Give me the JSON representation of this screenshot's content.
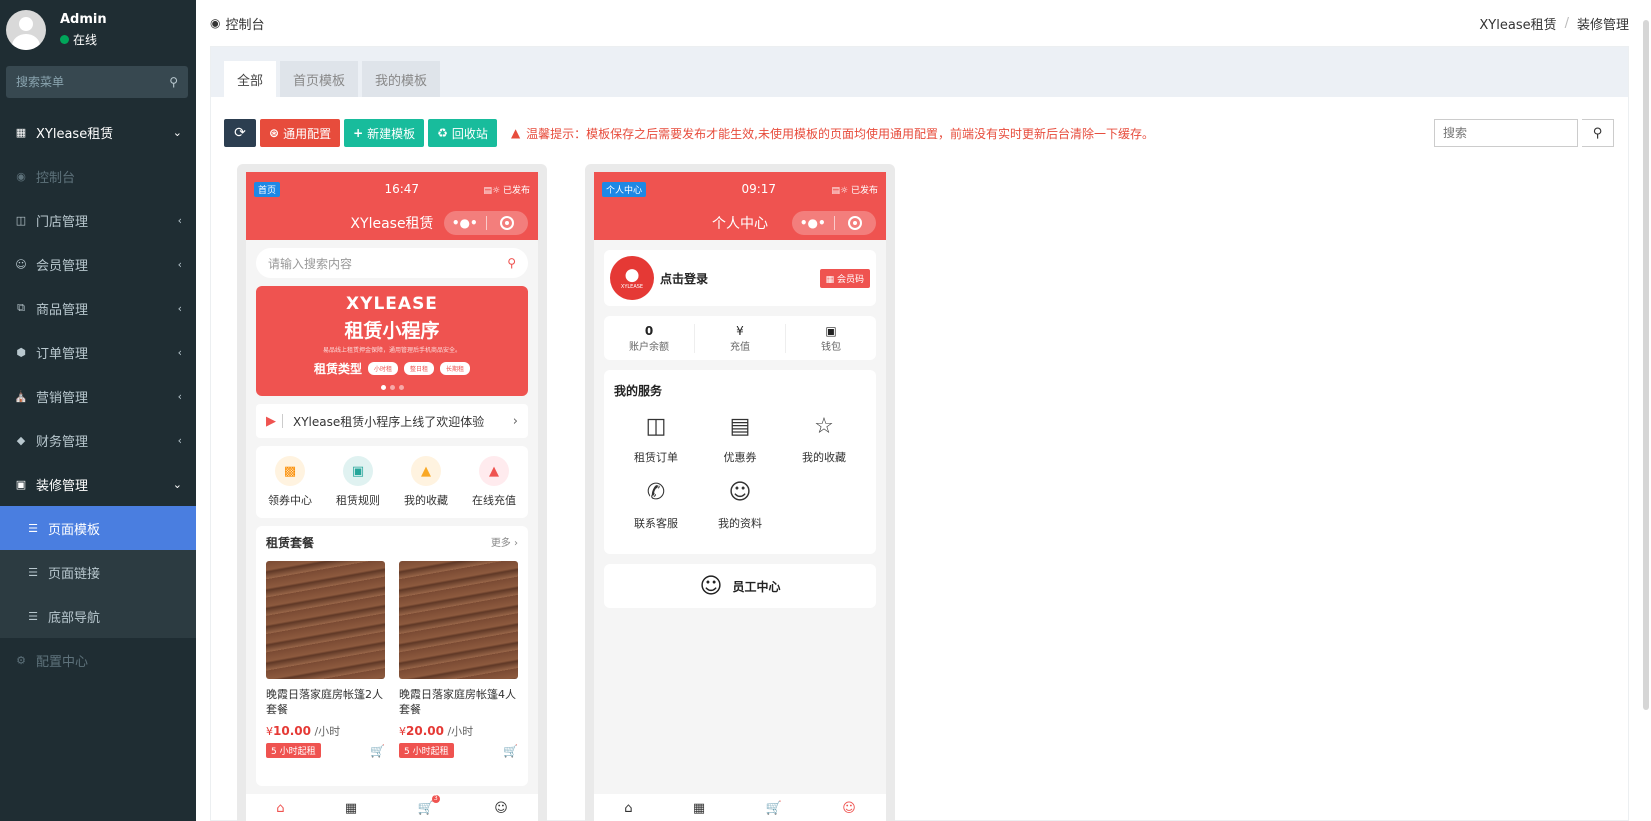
{
  "user": {
    "name": "Admin",
    "status": "在线"
  },
  "menu_search": {
    "placeholder": "搜索菜单"
  },
  "menu": {
    "root": "XYlease租赁",
    "dashboard": "控制台",
    "items": [
      {
        "label": "门店管理",
        "icon": "store-icon"
      },
      {
        "label": "会员管理",
        "icon": "user-icon"
      },
      {
        "label": "商品管理",
        "icon": "goods-icon"
      },
      {
        "label": "订单管理",
        "icon": "order-icon"
      },
      {
        "label": "营销管理",
        "icon": "marketing-icon"
      },
      {
        "label": "财务管理",
        "icon": "diamond-icon"
      }
    ],
    "decoration": "装修管理",
    "sub": [
      "页面模板",
      "页面链接",
      "底部导航"
    ],
    "config": "配置中心"
  },
  "topbar": {
    "title": "控制台",
    "breadcrumb": [
      "XYlease租赁",
      "装修管理"
    ]
  },
  "tabs": [
    "全部",
    "首页模板",
    "我的模板"
  ],
  "toolbar": {
    "general_config": "通用配置",
    "new_template": "新建模板",
    "recycle_bin": "回收站",
    "tip": "温馨提示：模板保存之后需要发布才能生效,未使用模板的页面均使用通用配置，前端没有实时更新后台清除一下缓存。",
    "search_placeholder": "搜索"
  },
  "home_phone": {
    "tag": "首页",
    "time": "16:47",
    "status": "已发布",
    "title": "XYlease租赁",
    "search_placeholder": "请输入搜索内容",
    "banner": {
      "line1": "XYLEASE",
      "line2": "租赁小程序",
      "line3": "易品线上租赁押金保障，通用管理后手机商品安全。",
      "type_label": "租赁类型",
      "pills": [
        "小时租",
        "整日租",
        "长期租"
      ]
    },
    "notice": "XYlease租赁小程序上线了欢迎体验",
    "quick": [
      {
        "label": "领券中心",
        "bg": "#fff3e0",
        "fg": "#fb8c00"
      },
      {
        "label": "租赁规则",
        "bg": "#e0f2f1",
        "fg": "#26a69a"
      },
      {
        "label": "我的收藏",
        "bg": "#fff3e0",
        "fg": "#f9a825"
      },
      {
        "label": "在线充值",
        "bg": "#ffebee",
        "fg": "#ef5350"
      }
    ],
    "packages": {
      "title": "租赁套餐",
      "more": "更多",
      "items": [
        {
          "name": "晚霞日落家庭房帐篷2人套餐",
          "currency": "¥",
          "price": "10.00",
          "unit": "/小时",
          "tag": "5 小时起租"
        },
        {
          "name": "晚霞日落家庭房帐篷4人套餐",
          "currency": "¥",
          "price": "20.00",
          "unit": "/小时",
          "tag": "5 小时起租"
        }
      ]
    },
    "cart_count": "3"
  },
  "center_phone": {
    "tag": "个人中心",
    "time": "09:17",
    "status": "已发布",
    "title": "个人中心",
    "logo_text": "XYLEASE",
    "login": "点击登录",
    "member_code": "会员码",
    "stats": [
      {
        "value": "0",
        "label": "账户余额"
      },
      {
        "label": "充值"
      },
      {
        "label": "钱包"
      }
    ],
    "services_title": "我的服务",
    "services": [
      "租赁订单",
      "优惠券",
      "我的收藏",
      "联系客服",
      "我的资料"
    ],
    "staff": "员工中心"
  },
  "colors": {
    "sidebar": "#1f2d33",
    "active": "#4a7ee0",
    "accent": "#ef5350",
    "green": "#18bc9c",
    "red": "#e74c3c"
  }
}
